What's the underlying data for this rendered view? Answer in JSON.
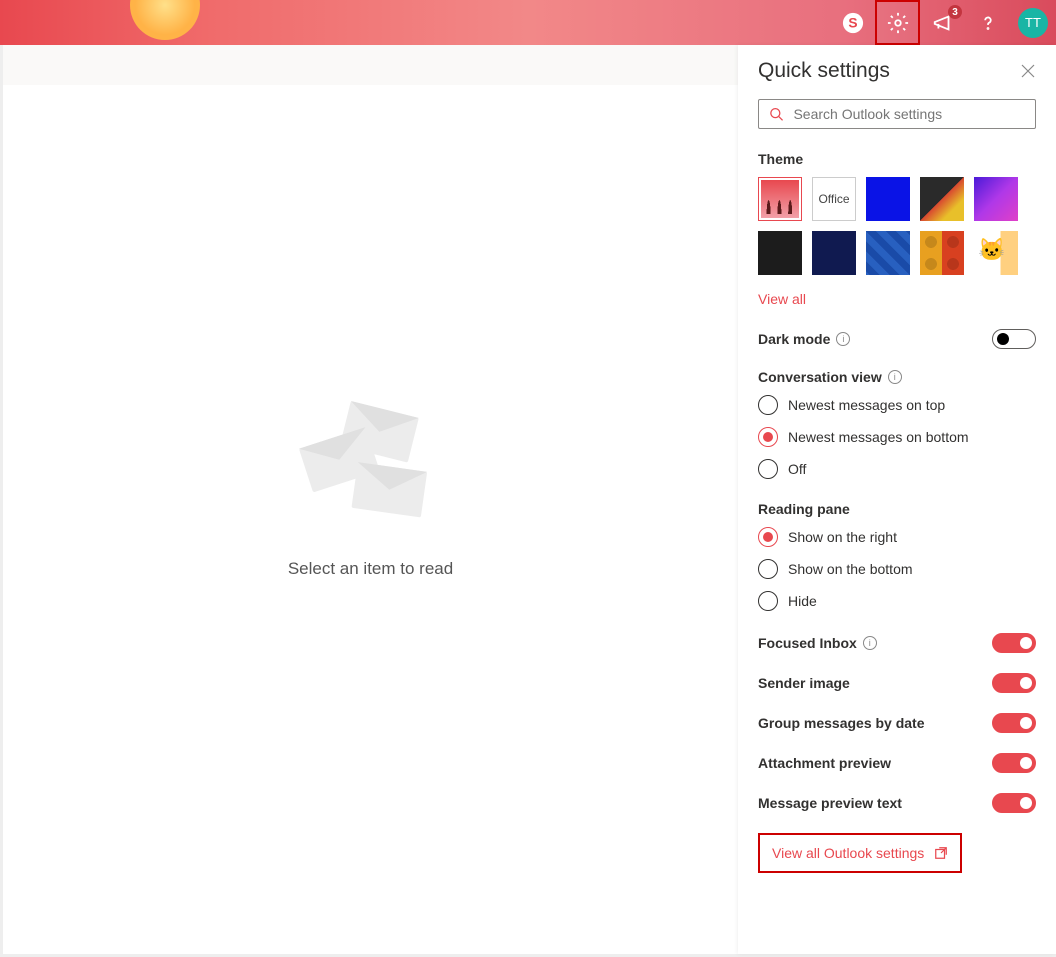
{
  "header": {
    "notification_count": "3",
    "avatar_initials": "TT"
  },
  "main": {
    "empty_message": "Select an item to read"
  },
  "panel": {
    "title": "Quick settings",
    "search_placeholder": "Search Outlook settings",
    "theme_label": "Theme",
    "office_theme": "Office",
    "view_all": "View all",
    "dark_mode_label": "Dark mode",
    "conversation_view_label": "Conversation view",
    "conv_options": {
      "top": "Newest messages on top",
      "bottom": "Newest messages on bottom",
      "off": "Off"
    },
    "reading_pane_label": "Reading pane",
    "reading_options": {
      "right": "Show on the right",
      "bottom": "Show on the bottom",
      "hide": "Hide"
    },
    "focused_inbox": "Focused Inbox",
    "sender_image": "Sender image",
    "group_by_date": "Group messages by date",
    "attachment_preview": "Attachment preview",
    "message_preview_text": "Message preview text",
    "view_all_settings": "View all Outlook settings"
  }
}
